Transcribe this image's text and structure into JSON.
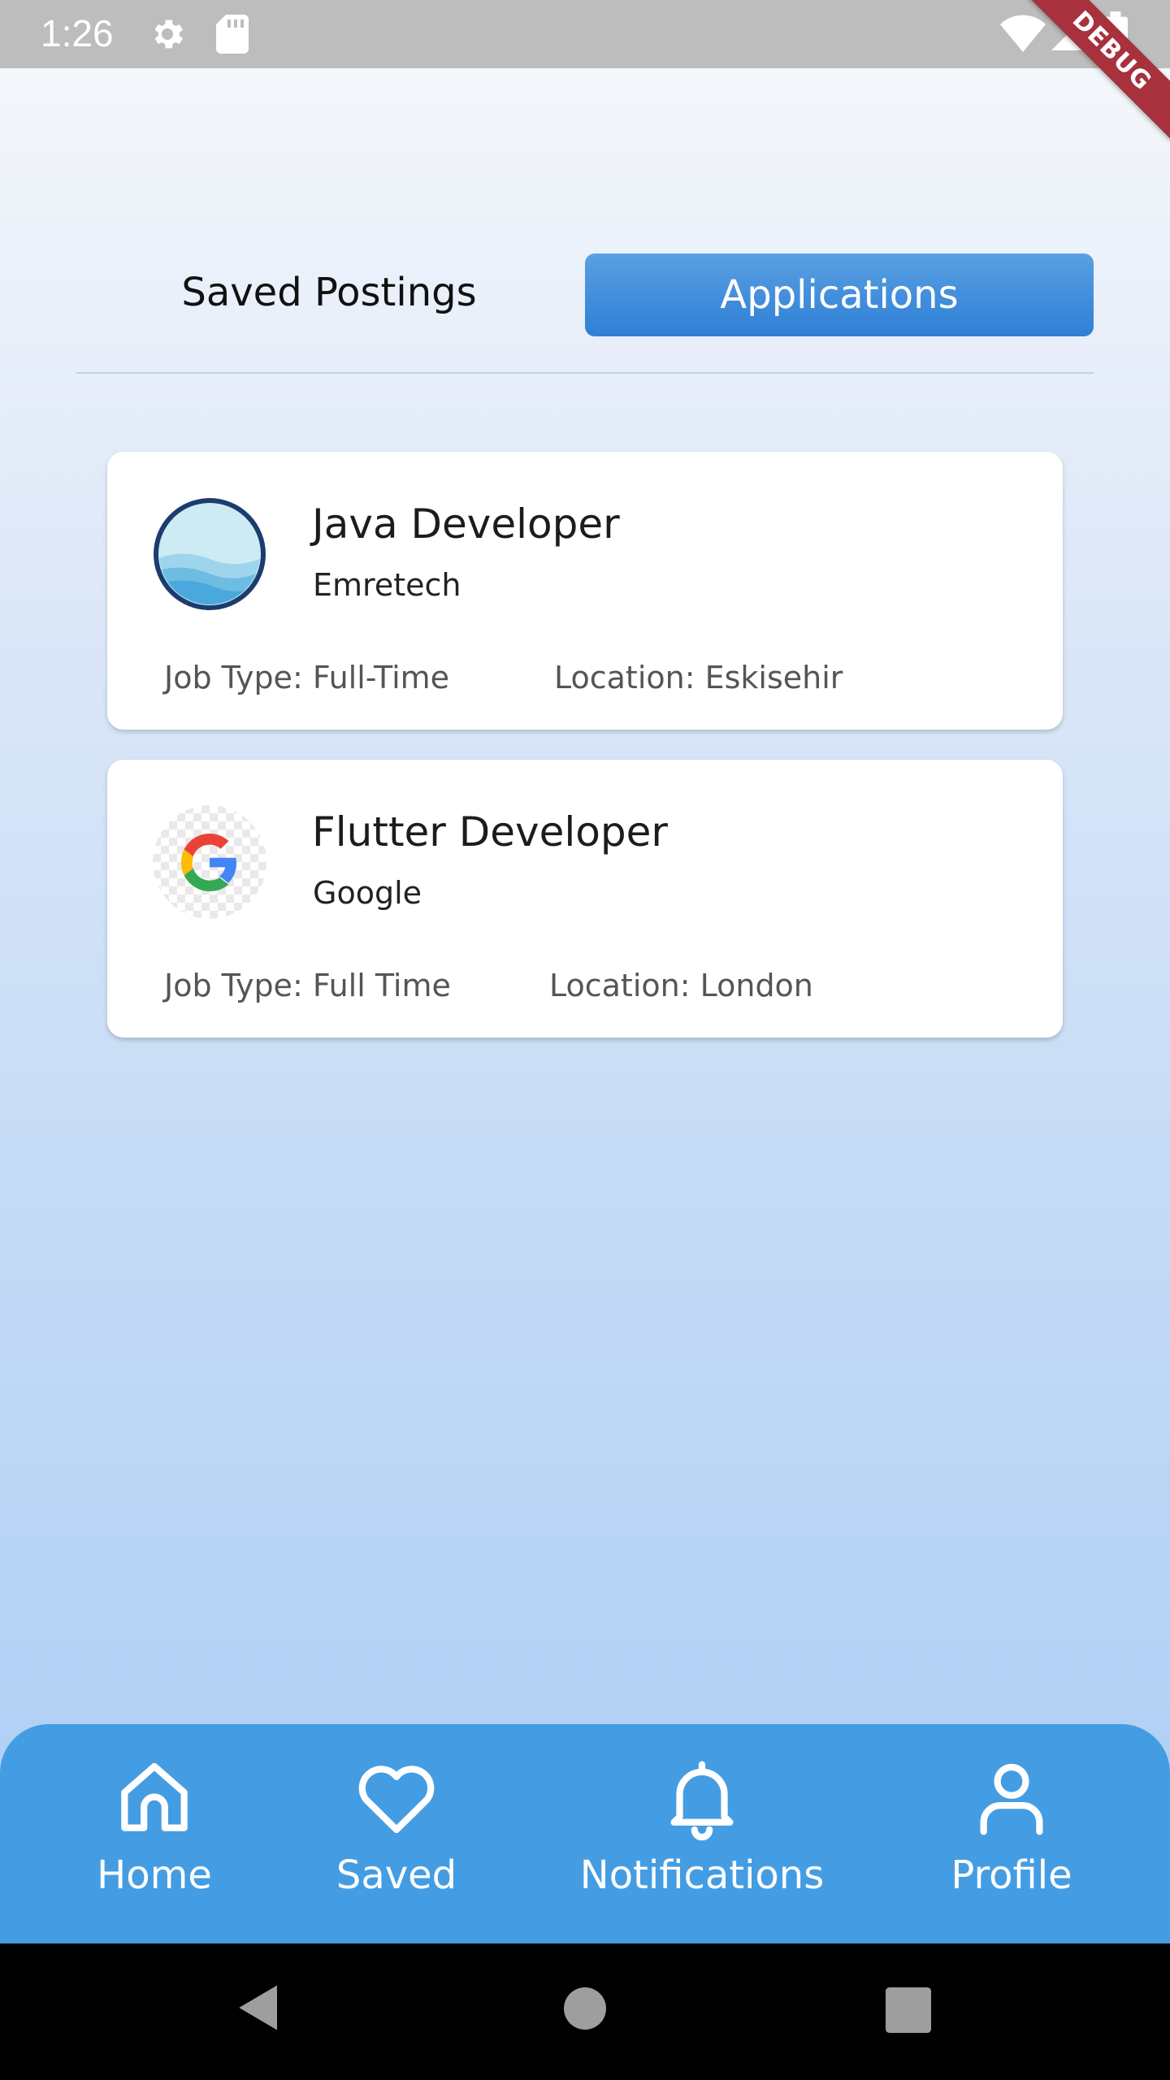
{
  "status_bar": {
    "time": "1:26",
    "icons": [
      "gear-icon",
      "sd-card-icon",
      "wifi-icon",
      "signal-icon",
      "battery-icon"
    ]
  },
  "debug_banner": "DEBUG",
  "tabs": {
    "saved_label": "Saved Postings",
    "applications_label": "Applications",
    "active": "Applications"
  },
  "jobs": [
    {
      "title": "Java Developer",
      "company": "Emretech",
      "job_type": "Job Type: Full-Time",
      "location": "Location: Eskisehir",
      "logo": "emretech-logo"
    },
    {
      "title": "Flutter Developer",
      "company": "Google",
      "job_type": "Job Type: Full Time",
      "location": "Location: London",
      "logo": "google-logo"
    }
  ],
  "bottom_nav": {
    "home": "Home",
    "saved": "Saved",
    "notifications": "Notifications",
    "profile": "Profile"
  },
  "system_nav": {
    "icons": [
      "back-icon",
      "home-circle-icon",
      "recents-icon"
    ]
  },
  "colors": {
    "accent": "#449de3",
    "active_tab": "#2e7fd6",
    "debug": "#a7313d"
  }
}
